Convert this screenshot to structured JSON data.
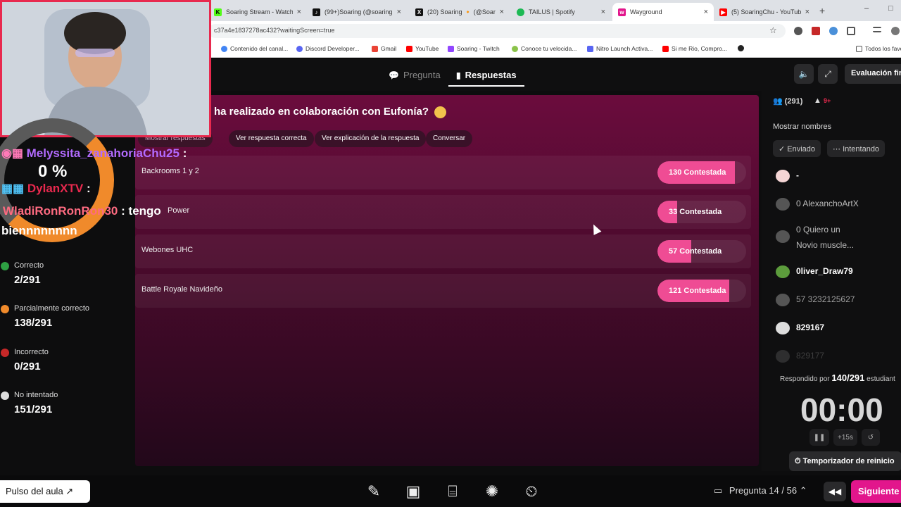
{
  "browser": {
    "tabs": [
      {
        "label": "Soaring Stream - Watch",
        "color": "#53fc18"
      },
      {
        "label": "(99+)Soaring (@soaring",
        "color": "#111111"
      },
      {
        "label": "(20) Soaring 🔸 (@Soar",
        "color": "#111111"
      },
      {
        "label": "TAILUS | Spotify",
        "color": "#1db954"
      },
      {
        "label": "Wayground",
        "color": "#e2168c"
      },
      {
        "label": "(5) SoaringChu - YouTub",
        "color": "#ff0000"
      }
    ],
    "active_tab_index": 4,
    "url": "c37a4e1837278ac432?waitingScreen=true",
    "bookmarks": [
      {
        "label": "Contenido del canal...",
        "color": "#4285f4"
      },
      {
        "label": "Discord Developer...",
        "color": "#5865f2"
      },
      {
        "label": "Gmail",
        "color": "#ea4335"
      },
      {
        "label": "YouTube",
        "color": "#ff0000"
      },
      {
        "label": "Soaring - Twitch",
        "color": "#9146ff"
      },
      {
        "label": "Conoce tu velocida...",
        "color": "#8bc34a"
      },
      {
        "label": "Nitro Launch Activa...",
        "color": "#5865f2"
      },
      {
        "label": "Si me Rio, Compro...",
        "color": "#ff0000"
      },
      {
        "label": "",
        "color": "#222222"
      }
    ],
    "bookmarks_folder": "Todos los favo"
  },
  "app": {
    "nav_tabs": {
      "question": "Pregunta",
      "answers": "Respuestas"
    },
    "eval_button": "Evaluación fir",
    "question_text": "ha realizado en colaboración con Eufonía?",
    "actions": {
      "show_answers": "Mostrar respuestas",
      "show_correct": "Ver respuesta correcta",
      "show_explanation": "Ver explicación de la respuesta",
      "converse": "Conversar"
    },
    "options": [
      {
        "label": "Backrooms 1 y 2",
        "count_label": "130 Contestada",
        "count": 130
      },
      {
        "label": "Power",
        "count_label": "33 Contestada",
        "count": 33
      },
      {
        "label": "Webones UHC",
        "count_label": "57 Contestada",
        "count": 57
      },
      {
        "label": "Battle Royale Navideño",
        "count_label": "121 Contestada",
        "count": 121
      }
    ],
    "total": 291,
    "accent_color": "#ef4c94"
  },
  "overlay": {
    "percent": "0 %",
    "chat": [
      {
        "user": "Melyssita_zanahoriaChu25",
        "sep": ":",
        "color": "#b36bff"
      },
      {
        "user": "DylanXTV",
        "sep": ":",
        "color": "#e8294e"
      },
      {
        "user": "WladiRonRonRon30",
        "sep": ":",
        "message": "tengo bienннnnnnn",
        "color": "#ff6b81"
      }
    ],
    "chat_message_line1": "tengo",
    "chat_message_line2": "biennnnnnnn",
    "stats": [
      {
        "label": "Correcto",
        "value": "2/291",
        "color": "#2ea043"
      },
      {
        "label": "Parcialmente correcto",
        "value": "138/291",
        "color": "#f08a2b"
      },
      {
        "label": "Incorrecto",
        "value": "0/291",
        "color": "#c62828"
      },
      {
        "label": "No intentado",
        "value": "151/291",
        "color": "#dddddd"
      }
    ]
  },
  "sidebar": {
    "participants": "(291)",
    "alerts": "9+",
    "show_names": "Mostrar nombres",
    "chips": {
      "sent": "Enviado",
      "trying": "Intentando"
    },
    "students": [
      {
        "name": "-",
        "color": "#ffffff"
      },
      {
        "name": "0 AlexanchoArtX",
        "color": "#bdbdbd"
      },
      {
        "name": "0 Quiero un",
        "color": "#bdbdbd"
      },
      {
        "name": "Novio muscle...",
        "color": "#bdbdbd"
      },
      {
        "name": "0liver_Draw79",
        "color": "#ffffff"
      },
      {
        "name": "57 3232125627",
        "color": "#9e9e9e"
      },
      {
        "name": "829167",
        "color": "#ffffff"
      },
      {
        "name": "829177",
        "color": "#5a5a5a"
      }
    ],
    "answered_prefix": "Respondido por",
    "answered_value": "140/291",
    "answered_suffix": "estudiant",
    "timer": "00:00",
    "timer_add": "+15s",
    "restart_timer": "Temporizador de reinicio"
  },
  "footer": {
    "pulse": "Pulso del aula",
    "question_nav": "Pregunta 14 / 56",
    "next": "Siguiente"
  }
}
